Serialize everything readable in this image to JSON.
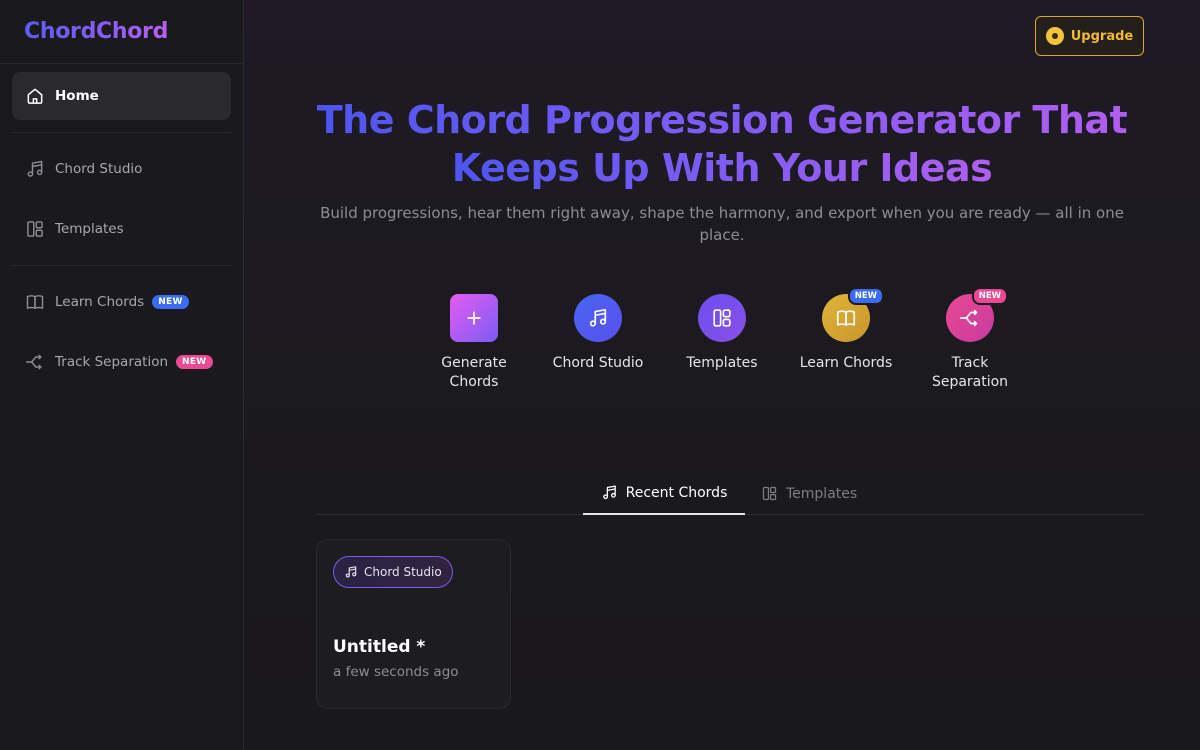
{
  "brand": {
    "name": "ChordChord"
  },
  "sidebar": {
    "items": [
      {
        "label": "Home",
        "icon": "home-icon"
      },
      {
        "label": "Chord Studio",
        "icon": "music-note-icon"
      },
      {
        "label": "Templates",
        "icon": "templates-icon"
      },
      {
        "label": "Learn Chords",
        "icon": "book-icon",
        "badge": "NEW"
      },
      {
        "label": "Track Separation",
        "icon": "split-arrows-icon",
        "badge": "NEW"
      }
    ]
  },
  "header": {
    "upgrade_label": "Upgrade"
  },
  "hero": {
    "title_line1": "The Chord Progression Generator That",
    "title_line2": "Keeps Up With Your Ideas",
    "subtitle": "Build progressions, hear them right away, shape the harmony, and export when you are ready — all in one place."
  },
  "actions": [
    {
      "label": "Generate Chords",
      "icon": "plus-icon"
    },
    {
      "label": "Chord Studio",
      "icon": "music-note-icon"
    },
    {
      "label": "Templates",
      "icon": "templates-icon"
    },
    {
      "label": "Learn Chords",
      "icon": "book-icon",
      "badge": "NEW"
    },
    {
      "label": "Track Separation",
      "icon": "split-arrows-icon",
      "badge": "NEW"
    }
  ],
  "tabs": [
    {
      "label": "Recent Chords",
      "active": true
    },
    {
      "label": "Templates",
      "active": false
    }
  ],
  "recent": [
    {
      "tag": "Chord Studio",
      "title": "Untitled *",
      "time": "a few seconds ago"
    }
  ],
  "colors": {
    "accent_blue": "#4f55f0",
    "accent_purple": "#8b5cf6",
    "upgrade_gold": "#f0b93a",
    "badge_blue": "#3b6cf0",
    "badge_pink": "#e94a93"
  }
}
